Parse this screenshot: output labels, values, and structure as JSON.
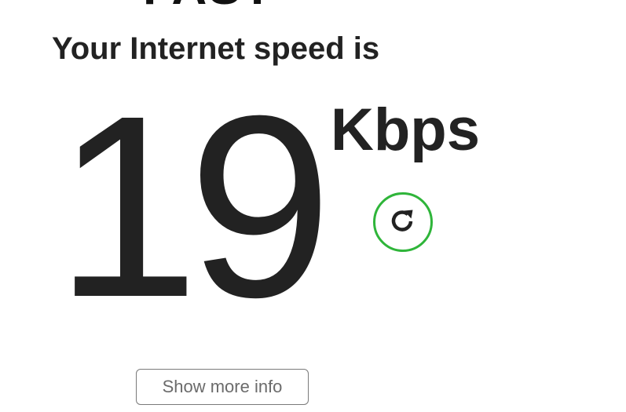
{
  "header": {
    "logo_text": "FAST"
  },
  "result": {
    "headline": "Your Internet speed is",
    "speed_value": "19",
    "speed_units": "Kbps"
  },
  "controls": {
    "refresh_icon": "refresh-icon",
    "show_more_label": "Show more info"
  },
  "colors": {
    "accent": "#2fb53a",
    "text": "#222222",
    "button_border": "#7a7a7a",
    "button_text": "#6b6b6b"
  }
}
